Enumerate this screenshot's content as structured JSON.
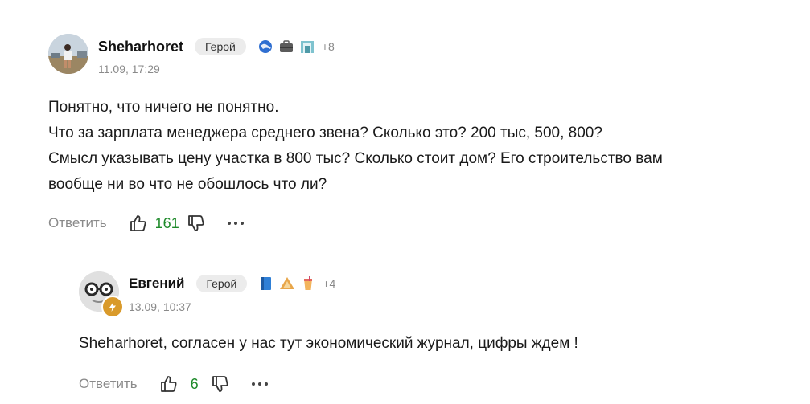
{
  "comments": [
    {
      "author": "Sheharhoret",
      "badge": "Герой",
      "more_awards": "+8",
      "award_icons": [
        "globe-award-icon",
        "briefcase-award-icon",
        "building-award-icon"
      ],
      "date": "11.09, 17:29",
      "lines": [
        "Понятно, что ничего не понятно.",
        "Что за зарплата менеджера среднего звена? Сколько это? 200 тыс, 500, 800?",
        "Смысл указывать цену участка в 800 тыс? Сколько стоит дом? Его строительство вам",
        "вообще ни во что не обошлось что ли?"
      ],
      "reply_label": "Ответить",
      "likes": "161"
    },
    {
      "author": "Евгений",
      "badge": "Герой",
      "more_awards": "+4",
      "award_icons": [
        "book-award-icon",
        "triangle-award-icon",
        "drink-award-icon"
      ],
      "date": "13.09, 10:37",
      "lines": [
        "Sheharhoret, согласен у нас тут экономический журнал, цифры ждем !"
      ],
      "reply_label": "Ответить",
      "likes": "6"
    }
  ],
  "colors": {
    "like_count": "#1e8a2a",
    "muted": "#8a8a8a",
    "badge_bg": "#ececec"
  }
}
